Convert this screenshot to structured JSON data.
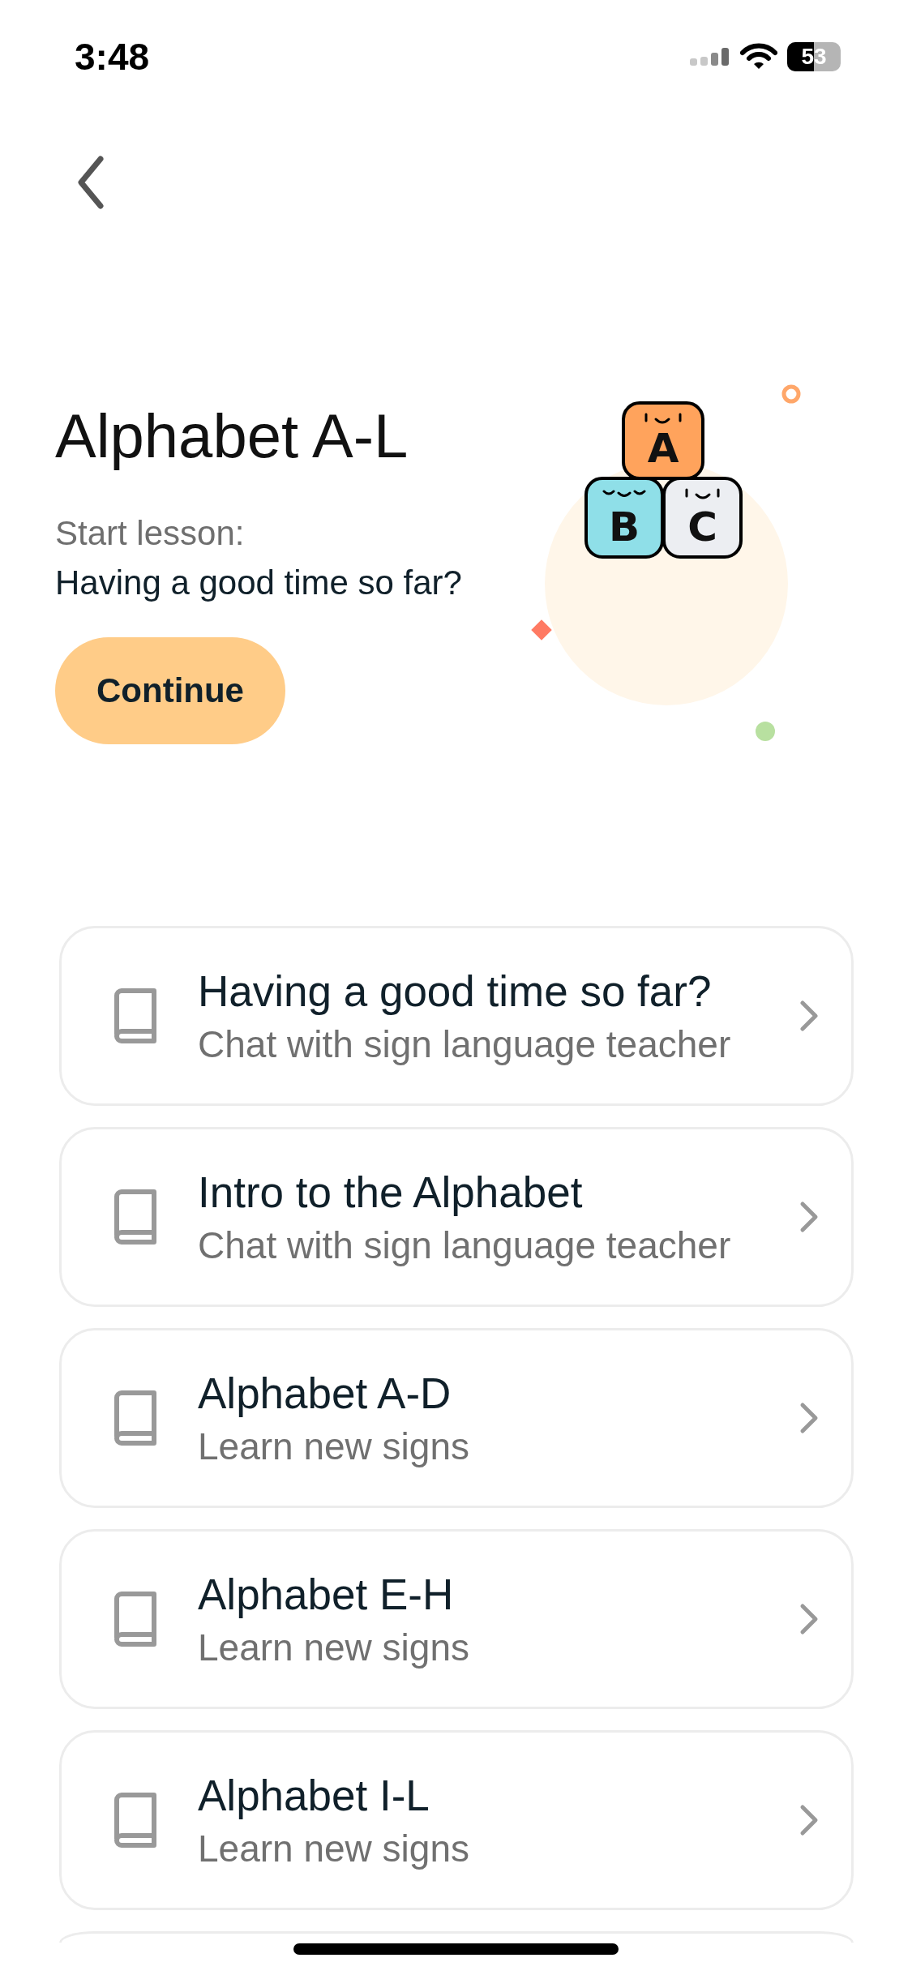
{
  "status_bar": {
    "time": "3:48",
    "battery": "53"
  },
  "header": {
    "title": "Alphabet A-L",
    "caption": "Start lesson:",
    "next_lesson": "Having a good time so far?",
    "button": "Continue"
  },
  "illustration": {
    "letters": [
      "A",
      "B",
      "C"
    ]
  },
  "lessons": [
    {
      "title": "Having a good time so far?",
      "subtitle": "Chat with sign language teacher"
    },
    {
      "title": "Intro to the Alphabet",
      "subtitle": "Chat with sign language teacher"
    },
    {
      "title": "Alphabet A-D",
      "subtitle": "Learn new signs"
    },
    {
      "title": "Alphabet E-H",
      "subtitle": "Learn new signs"
    },
    {
      "title": "Alphabet I-L",
      "subtitle": "Learn new signs"
    }
  ]
}
